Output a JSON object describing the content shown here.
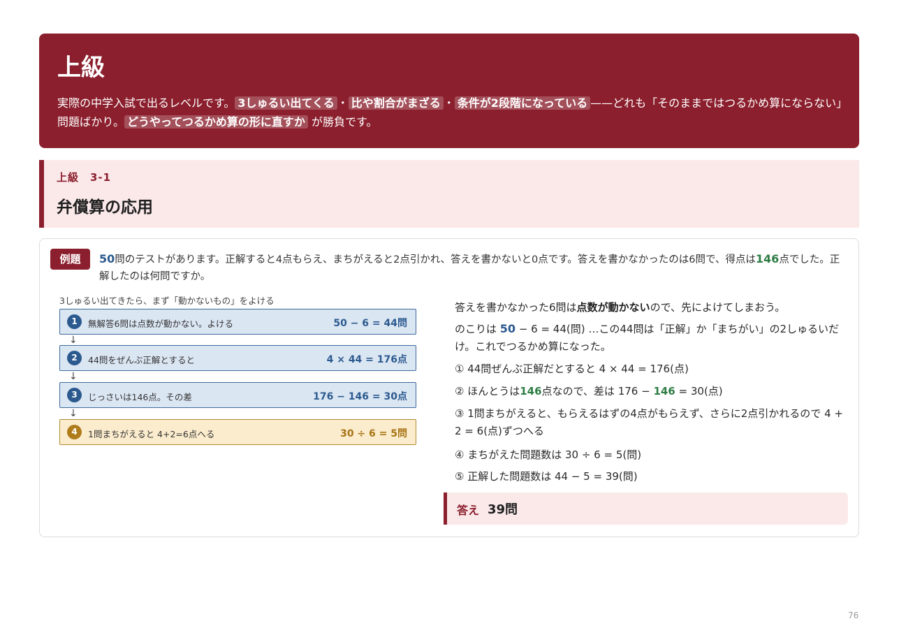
{
  "banner": {
    "title": "上級",
    "desc_1": "実際の中学入試で出るレベルです。",
    "chip_1": "3しゅるい出てくる",
    "sep_1": "・",
    "chip_2": "比や割合がまざる",
    "sep_2": "・",
    "chip_3": "条件が2段階になっている",
    "desc_2": "——どれも「そのままではつるかめ算にならない」問題ばかり。",
    "chip_4": "どうやってつるかめ算の形に直すか",
    "desc_3": "が勝負です。"
  },
  "section": {
    "kicker": "上級　3-1",
    "title": "弁償算の応用"
  },
  "problem": {
    "badge": "例題",
    "num_total": "50",
    "text_1": "問のテストがあります。正解すると4点もらえ、まちがえると2点引かれ、答えを書かないと0点です。答えを書かなかったのは6問で、得点は",
    "num_score": "146",
    "text_2": "点でした。正解したのは何問ですか。"
  },
  "flow": {
    "caption": "3しゅるい出てきたら、まず「動かないもの」をよける",
    "steps": [
      {
        "num": "1",
        "text": "無解答6問は点数が動かない。よける",
        "eq": "50 − 6 = 44問"
      },
      {
        "num": "2",
        "text": "44問をぜんぶ正解とすると",
        "eq": "4 × 44 = 176点"
      },
      {
        "num": "3",
        "text": "じっさいは146点。その差",
        "eq": "176 − 146 = 30点"
      },
      {
        "num": "4",
        "text": "1問まちがえると 4+2=6点へる",
        "eq": "30 ÷ 6 = 5問"
      }
    ],
    "arrow": "↓"
  },
  "explanation": {
    "p1_a": "答えを書かなかった6問は",
    "p1_b": "点数が動かない",
    "p1_c": "ので、先によけてしまおう。",
    "p2_a": "のこりは ",
    "p2_num": "50",
    "p2_b": " − 6 = 44(問) …この44問は「正解」か「まちがい」の2しゅるいだけ。これでつるかめ算になった。",
    "s1": "① 44問ぜんぶ正解だとすると 4 × 44 = 176(点)",
    "s2_a": "② ほんとうは",
    "s2_num": "146",
    "s2_b": "点なので、差は 176 − ",
    "s2_num2": "146",
    "s2_c": " = 30(点)",
    "s3": "③ 1問まちがえると、もらえるはずの4点がもらえず、さらに2点引かれるので 4 + 2 = 6(点)ずつへる",
    "s4": "④ まちがえた問題数は 30 ÷ 6 = 5(問)",
    "s5": "⑤ 正解した問題数は 44 − 5 = 39(問)"
  },
  "answer": {
    "label": "答え",
    "value": "39問"
  },
  "page_number": "76",
  "colors": {
    "accent": "#8b1f2d",
    "blue": "#2c5a8f",
    "green": "#2e7d45",
    "gold": "#b07b1a"
  }
}
